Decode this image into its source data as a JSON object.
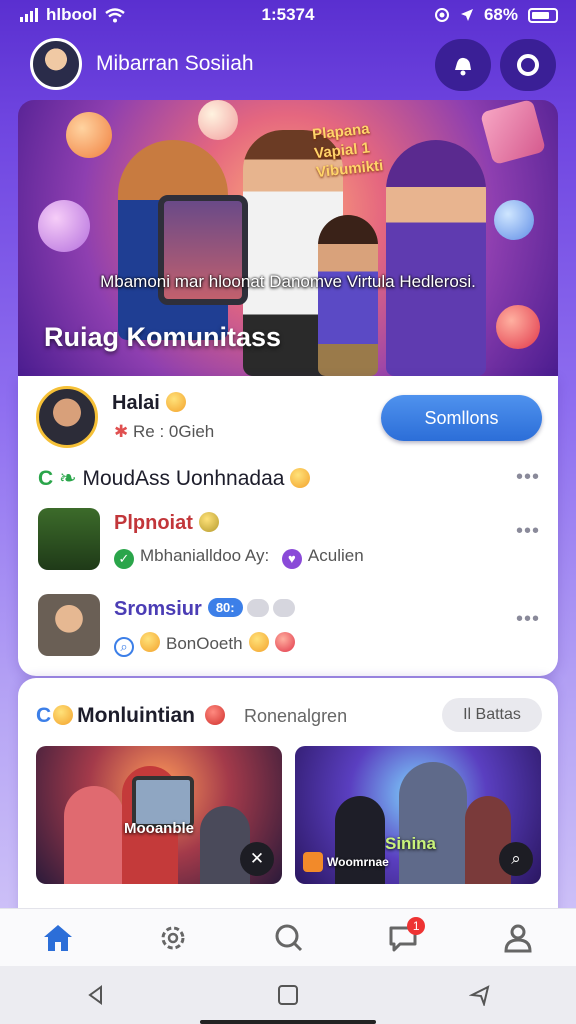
{
  "status_bar": {
    "carrier": "hlbool",
    "time": "1:5374",
    "battery": "68%"
  },
  "header": {
    "title": "Mibarran Sosiiah"
  },
  "hero": {
    "sign": "Plapana Vapial 1 Vibumikti",
    "caption": "Mbamoni mar hloonat Danomve Virtula Hedlerosi.",
    "title": "Ruiag Komunitass"
  },
  "profile": {
    "name": "Halai",
    "status": "Re : 0Gieh",
    "button": "Somllons"
  },
  "feed": {
    "section_title": "MoudAss Uonhnadaa",
    "section_prefix": "C",
    "posts": [
      {
        "name": "Plpnoiat",
        "meta": "Mbhanialldoo Ay:",
        "tag": "Aculien"
      },
      {
        "name": "Sromsiur",
        "badge": "80:",
        "meta": "BonOoeth"
      }
    ]
  },
  "community": {
    "title": "Monluintian",
    "title_prefix": "C",
    "subtitle": "Ronenalgren",
    "filter": "Il Battas",
    "thumbs": [
      {
        "label": "Mooanble"
      },
      {
        "label": "Sinina",
        "tag": "Woomrnae"
      }
    ]
  },
  "colors": {
    "accent": "#3c7fe8",
    "header_bg": "#5a2fd0",
    "notification": "#e33333"
  },
  "tabs": [
    {
      "icon": "home-icon",
      "active": true
    },
    {
      "icon": "settings-icon"
    },
    {
      "icon": "search-icon"
    },
    {
      "icon": "chat-icon",
      "badge": "1"
    },
    {
      "icon": "profile-icon"
    }
  ]
}
